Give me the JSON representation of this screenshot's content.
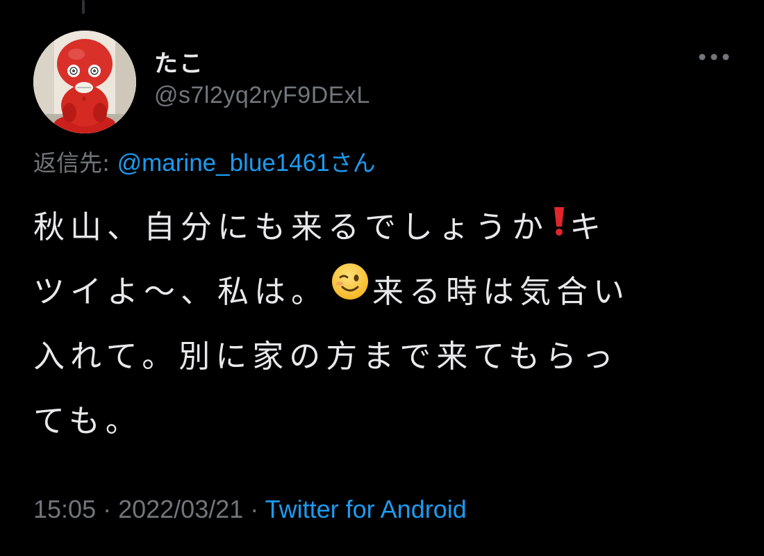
{
  "author": {
    "display_name": "たこ",
    "handle": "@s7l2yq2ryF9DExL"
  },
  "reply": {
    "prefix": "返信先: ",
    "mention": "@marine_blue1461",
    "suffix": "さん"
  },
  "tweet": {
    "line1_text": "秋山、自分にも来るでしょうか",
    "line1_icon": "red-exclamation-emoji",
    "line1_tail": "キ",
    "line2_text": "ツイよ〜、私は。",
    "line2_icon": "winking-face-emoji",
    "line2_tail": "来る時は気合い",
    "line3": "入れて。別に家の方まで来てもらっ",
    "line4": "ても。"
  },
  "meta": {
    "time": "15:05",
    "separator1": " · ",
    "date": "2022/03/21",
    "separator2": " · ",
    "source": "Twitter for Android"
  },
  "colors": {
    "background": "#000000",
    "text": "#e7e9ea",
    "secondary": "#71767b",
    "accent": "#1d9bf0"
  },
  "icons": {
    "more": "more-horizontal-icon",
    "avatar": "red-octopus-figure-avatar"
  }
}
